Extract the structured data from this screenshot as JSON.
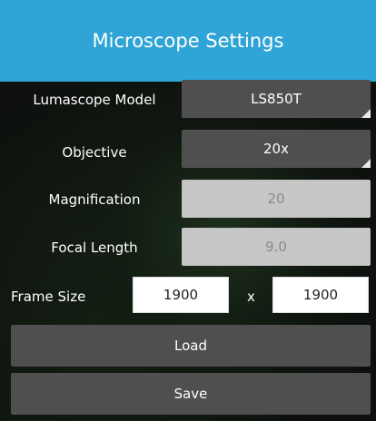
{
  "header": {
    "title": "Microscope Settings"
  },
  "settings": {
    "model": {
      "label": "Lumascope Model",
      "value": "LS850T"
    },
    "objective": {
      "label": "Objective",
      "value": "20x"
    },
    "magnification": {
      "label": "Magnification",
      "value": "20"
    },
    "focal_length": {
      "label": "Focal Length",
      "value": "9.0"
    }
  },
  "frame_size": {
    "label": "Frame Size",
    "width": "1900",
    "height": "1900",
    "separator": "x"
  },
  "actions": {
    "load_label": "Load",
    "save_label": "Save"
  },
  "colors": {
    "header_bg": "#2fa4d6",
    "button_bg": "#4f4f4f",
    "readonly_bg": "#c7c7c7"
  }
}
